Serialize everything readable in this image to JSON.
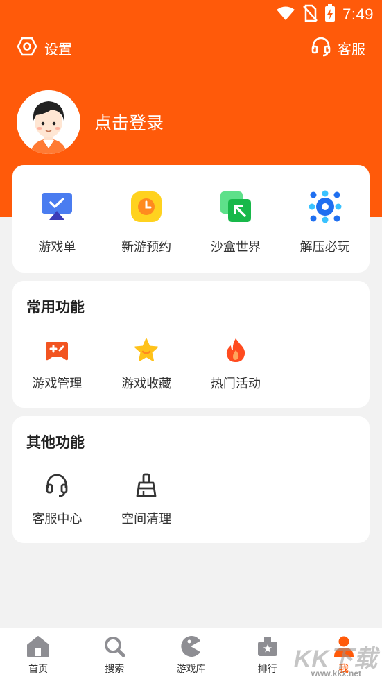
{
  "status_bar": {
    "time": "7:49",
    "icons": [
      "wifi-icon",
      "no-sim-icon",
      "battery-charging-icon"
    ]
  },
  "header": {
    "settings_label": "设置",
    "settings_icon": "gear-icon",
    "service_label": "客服",
    "service_icon": "headset-icon"
  },
  "profile": {
    "login_label": "点击登录",
    "avatar": "avatar"
  },
  "quick_entries": [
    {
      "label": "游戏单",
      "icon": "monitor-check-icon"
    },
    {
      "label": "新游预约",
      "icon": "clock-icon"
    },
    {
      "label": "沙盒世界",
      "icon": "arrow-box-icon"
    },
    {
      "label": "解压必玩",
      "icon": "bubbles-icon"
    }
  ],
  "common_functions": {
    "title": "常用功能",
    "items": [
      {
        "label": "游戏管理",
        "icon": "gamepad-icon"
      },
      {
        "label": "游戏收藏",
        "icon": "star-icon"
      },
      {
        "label": "热门活动",
        "icon": "fire-icon"
      }
    ]
  },
  "other_functions": {
    "title": "其他功能",
    "items": [
      {
        "label": "客服中心",
        "icon": "headset-icon"
      },
      {
        "label": "空间清理",
        "icon": "broom-icon"
      }
    ]
  },
  "tabbar": {
    "items": [
      {
        "label": "首页",
        "icon": "home-icon"
      },
      {
        "label": "搜索",
        "icon": "search-icon"
      },
      {
        "label": "游戏库",
        "icon": "pacman-icon"
      },
      {
        "label": "排行",
        "icon": "ranking-icon"
      },
      {
        "label": "我",
        "icon": "user-icon"
      }
    ],
    "active_index": 4
  },
  "watermark": {
    "brand": "KK下载",
    "url": "www.kkx.net"
  },
  "colors": {
    "accent": "#ff5a0a",
    "page_bg": "#f2f2f2",
    "card_bg": "#ffffff"
  }
}
